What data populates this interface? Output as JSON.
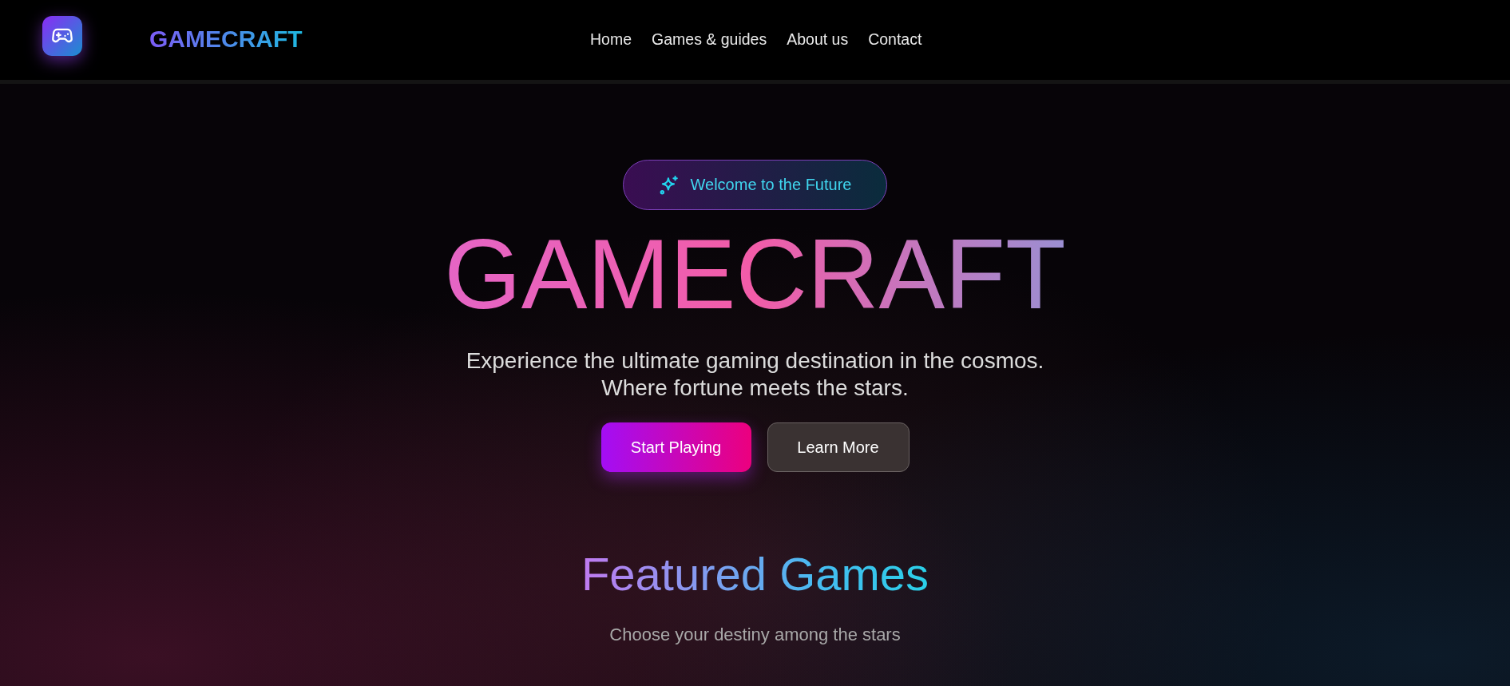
{
  "header": {
    "brand": "GAMECRAFT",
    "nav": [
      {
        "label": "Home"
      },
      {
        "label": "Games & guides"
      },
      {
        "label": "About us"
      },
      {
        "label": "Contact"
      }
    ]
  },
  "hero": {
    "badge": "Welcome to the Future",
    "title": "GAMECRAFT",
    "subtitle_lines": [
      "Experience the ultimate gaming destination in the cosmos.",
      "Where fortune meets the stars."
    ],
    "buttons": [
      {
        "label": "Start Playing",
        "kind": "primary"
      },
      {
        "label": "Learn More",
        "kind": "secondary"
      }
    ]
  },
  "featured": {
    "title": "Featured Games",
    "subtitle": "Choose your destiny among the stars"
  }
}
